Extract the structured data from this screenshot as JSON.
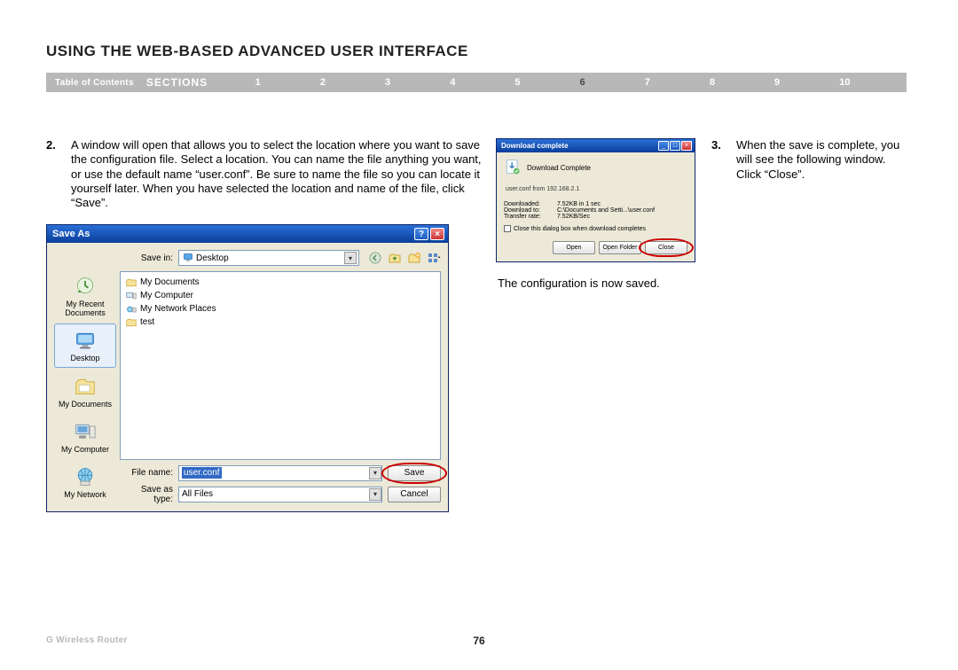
{
  "header": {
    "title": "USING THE WEB-BASED ADVANCED USER INTERFACE"
  },
  "nav": {
    "toc": "Table of Contents",
    "sections_label": "SECTIONS",
    "numbers": [
      "1",
      "2",
      "3",
      "4",
      "5",
      "6",
      "7",
      "8",
      "9",
      "10"
    ],
    "active_index": 5
  },
  "step2": {
    "num": "2.",
    "text": "A window will open that allows you to select the location where you want to save the configuration file. Select a location. You can name the file anything you want, or use the default name “user.conf”. Be sure to name the file so you can locate it yourself later. When you have selected the location and name of the file, click “Save”."
  },
  "step3": {
    "num": "3.",
    "text": "When the save is complete, you will see the following window. Click “Close”."
  },
  "saved_line": "The configuration is now saved.",
  "saveas": {
    "title": "Save As",
    "save_in_label": "Save in:",
    "save_in_value": "Desktop",
    "sidebar": {
      "recent": "My Recent Documents",
      "desktop": "Desktop",
      "mydocs": "My Documents",
      "mycomp": "My Computer",
      "mynet": "My Network"
    },
    "files": [
      "My Documents",
      "My Computer",
      "My Network Places",
      "test"
    ],
    "file_name_label": "File name:",
    "file_name_value": "user.conf",
    "save_as_type_label": "Save as type:",
    "save_as_type_value": "All Files",
    "btn_save": "Save",
    "btn_cancel": "Cancel"
  },
  "download": {
    "title": "Download complete",
    "heading": "Download Complete",
    "sub": "user.conf from 192.168.2.1",
    "rows": {
      "downloaded_k": "Downloaded:",
      "downloaded_v": "7.52KB in 1 sec",
      "downloadto_k": "Download to:",
      "downloadto_v": "C:\\Documents and Setti...\\user.conf",
      "rate_k": "Transfer rate:",
      "rate_v": "7.52KB/Sec"
    },
    "checkbox": "Close this dialog box when download completes",
    "btn_open": "Open",
    "btn_open_folder": "Open Folder",
    "btn_close": "Close"
  },
  "footer": {
    "product": "G Wireless Router",
    "page": "76"
  }
}
